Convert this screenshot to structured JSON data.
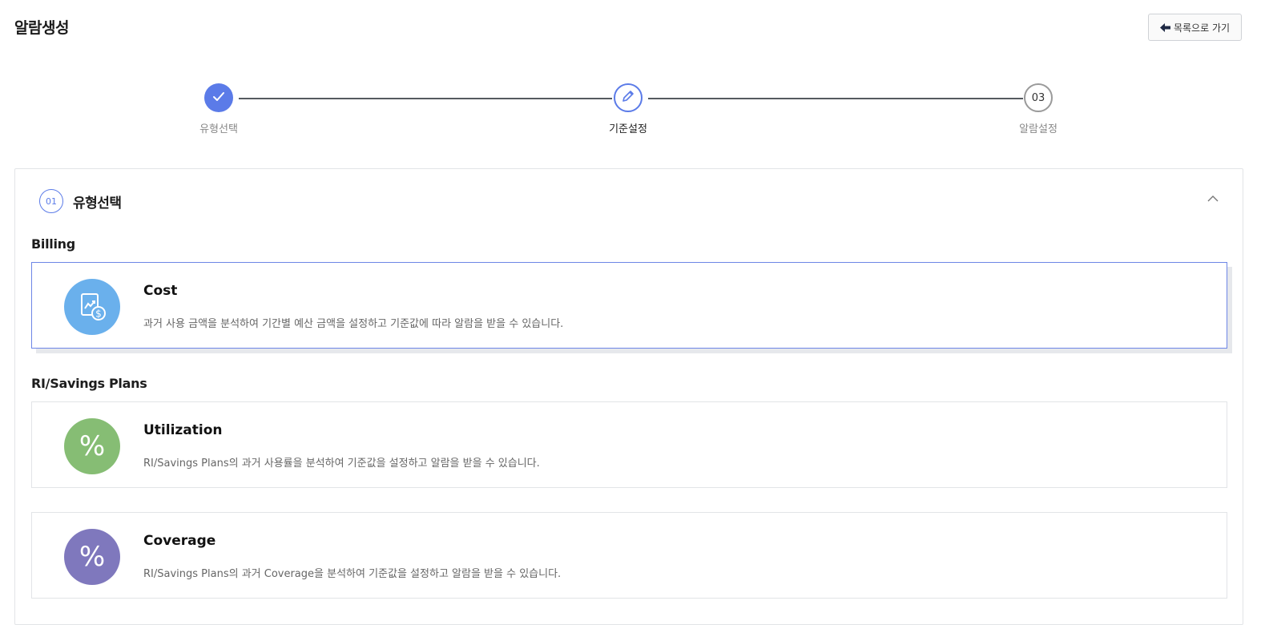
{
  "page": {
    "title": "알람생성"
  },
  "header": {
    "back_label": "목록으로 가기"
  },
  "stepper": {
    "steps": [
      {
        "label": "유형선택",
        "state": "done"
      },
      {
        "label": "기준설정",
        "state": "current"
      },
      {
        "label": "알람설정",
        "state": "todo",
        "number": "03"
      }
    ]
  },
  "section": {
    "number": "01",
    "title": "유형선택"
  },
  "groups": [
    {
      "label": "Billing",
      "cards": [
        {
          "title": "Cost",
          "description": "과거 사용 금액을 분석하여 기간별 예산 금액을 설정하고 기준값에 따라 알람을 받을 수 있습니다.",
          "icon": "cost-document-icon",
          "color": "#6ab0ec",
          "selected": true
        }
      ]
    },
    {
      "label": "RI/Savings Plans",
      "cards": [
        {
          "title": "Utilization",
          "description": "RI/Savings Plans의 과거 사용률을 분석하여 기준값을 설정하고 알람을 받을 수 있습니다.",
          "icon": "percent-icon",
          "color": "#86bd74",
          "selected": false
        },
        {
          "title": "Coverage",
          "description": "RI/Savings Plans의 과거 Coverage을 분석하여 기준값을 설정하고 알람을 받을 수 있습니다.",
          "icon": "percent-icon",
          "color": "#7f78bd",
          "selected": false
        }
      ]
    }
  ],
  "colors": {
    "accent": "#5b7be8",
    "step_line": "#555a60"
  }
}
